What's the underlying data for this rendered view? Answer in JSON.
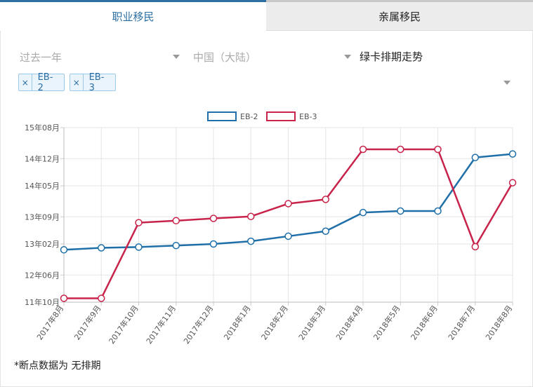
{
  "tabs": {
    "active": "职业移民",
    "inactive": "亲属移民"
  },
  "filters": {
    "period": "过去一年",
    "country": "中国（大陆）"
  },
  "heading": "绿卡排期走势",
  "tags": [
    {
      "remove": "×",
      "label": "EB-2"
    },
    {
      "remove": "×",
      "label": "EB-3"
    }
  ],
  "footnote": "*断点数据为 无排期",
  "colors": {
    "eb2": "#1f6fa8",
    "eb3": "#c8234a",
    "accent": "#2d6fa3"
  },
  "chart_data": {
    "type": "line",
    "categories": [
      "2017年8月",
      "2017年9月",
      "2017年10月",
      "2017年11月",
      "2017年12月",
      "2018年1月",
      "2018年2月",
      "2018年3月",
      "2018年4月",
      "2018年5月",
      "2018年6月",
      "2018年7月",
      "2018年8月"
    ],
    "y_ticks": [
      "15年08月",
      "14年12月",
      "14年05月",
      "13年09月",
      "13年02月",
      "12年06月",
      "11年10月"
    ],
    "y_tick_months": [
      187,
      179,
      172,
      164,
      157,
      149,
      142
    ],
    "ylim": [
      142,
      187
    ],
    "grid": true,
    "legend_position": "top",
    "series": [
      {
        "name": "EB-2",
        "color": "#1f6fa8",
        "values": [
          155.5,
          156,
          156.2,
          156.6,
          157,
          157.7,
          159,
          160.3,
          165.1,
          165.5,
          165.5,
          179.3,
          180.2
        ]
      },
      {
        "name": "EB-3",
        "color": "#c8234a",
        "values": [
          143.0,
          143.0,
          162.5,
          163.0,
          163.6,
          164.1,
          167.4,
          168.5,
          181.4,
          181.4,
          181.4,
          156.3,
          172.8
        ]
      }
    ]
  }
}
